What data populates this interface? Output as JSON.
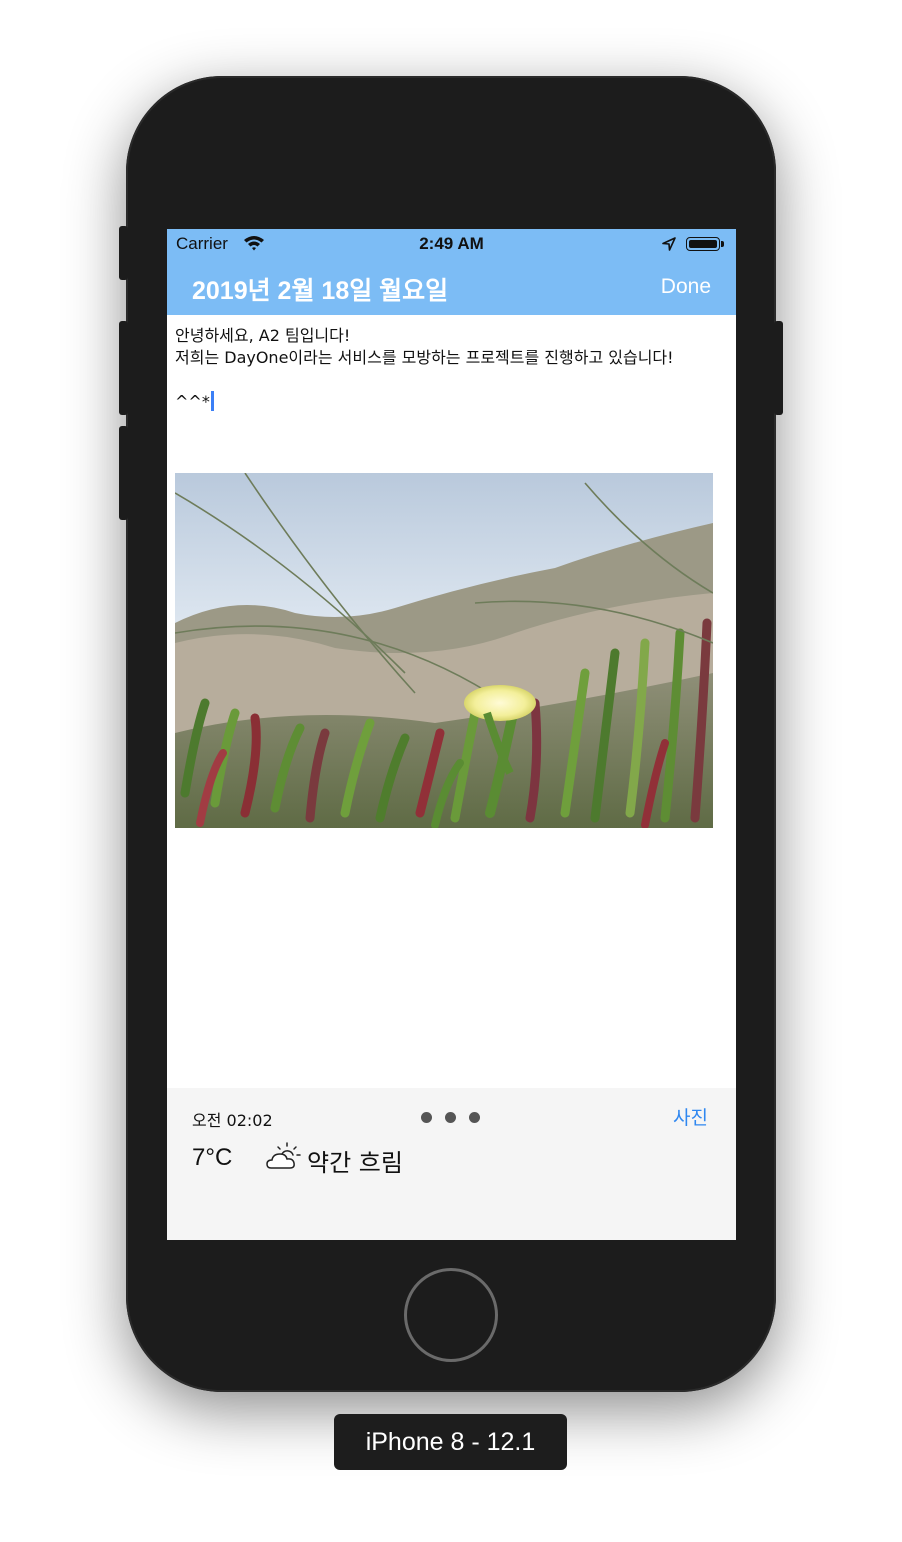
{
  "status_bar": {
    "carrier": "Carrier",
    "time": "2:49 AM"
  },
  "nav": {
    "title": "2019년 2월 18일 월요일",
    "done_label": "Done"
  },
  "entry": {
    "text": "안녕하세요, A2 팀입니다!\n저희는 DayOne이라는 서비스를 모방하는 프로젝트를 진행하고 있습니다!\n\n^^*"
  },
  "footer": {
    "time": "오전 02:02",
    "photo_button": "사진",
    "temperature": "7°C",
    "weather_icon": "cloud-sun-icon",
    "condition": "약간 흐림"
  },
  "device_label": "iPhone 8 - 12.1",
  "colors": {
    "nav_background": "#7cbcf5",
    "accent": "#2f87f0",
    "footer_background": "#f5f5f5"
  }
}
